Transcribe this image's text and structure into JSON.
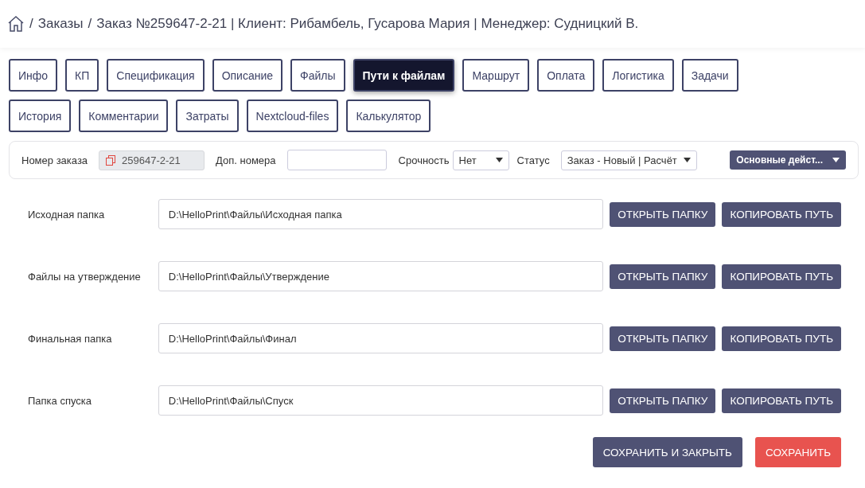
{
  "breadcrumb": {
    "separator": "/",
    "items": [
      "Заказы",
      "Заказ №259647-2-21 | Клиент: Рибамбель, Гусарова Мария | Менеджер: Судницкий В."
    ]
  },
  "tabs": [
    {
      "label": "Инфо",
      "selected": false
    },
    {
      "label": "КП",
      "selected": false
    },
    {
      "label": "Спецификация",
      "selected": false
    },
    {
      "label": "Описание",
      "selected": false
    },
    {
      "label": "Файлы",
      "selected": false
    },
    {
      "label": "Пути к файлам",
      "selected": true
    },
    {
      "label": "Маршрут",
      "selected": false
    },
    {
      "label": "Оплата",
      "selected": false
    },
    {
      "label": "Логистика",
      "selected": false
    },
    {
      "label": "Задачи",
      "selected": false
    },
    {
      "label": "История",
      "selected": false
    },
    {
      "label": "Комментарии",
      "selected": false
    },
    {
      "label": "Затраты",
      "selected": false
    },
    {
      "label": "Nextcloud-files",
      "selected": false
    },
    {
      "label": "Калькулятор",
      "selected": false
    }
  ],
  "info_bar": {
    "order_number_label": "Номер заказа",
    "order_number": "259647-2-21",
    "extra_numbers_label": "Доп. номера",
    "urgency_label": "Срочность",
    "urgency": "Нет",
    "status_label": "Статус",
    "status": "Заказ - Новый | Расчёт",
    "actions_button": "Основные дейст..."
  },
  "paths": [
    {
      "label": "Исходная папка",
      "value": "D:\\HelloPrint\\Файлы\\Исходная папка",
      "open_button": "ОТКРЫТЬ ПАПКУ",
      "copy_button": "КОПИРОВАТЬ ПУТЬ"
    },
    {
      "label": "Файлы на утверждение",
      "value": "D:\\HelloPrint\\Файлы\\Утверждение",
      "open_button": "ОТКРЫТЬ ПАПКУ",
      "copy_button": "КОПИРОВАТЬ ПУТЬ"
    },
    {
      "label": "Финальная папка",
      "value": "D:\\HelloPrint\\Файлы\\Финал",
      "open_button": "ОТКРЫТЬ ПАПКУ",
      "copy_button": "КОПИРОВАТЬ ПУТЬ"
    },
    {
      "label": "Папка спуска",
      "value": "D:\\HelloPrint\\Файлы\\Спуск",
      "open_button": "ОТКРЫТЬ ПАПКУ",
      "copy_button": "КОПИРОВАТЬ ПУТЬ"
    }
  ],
  "footer_buttons": [
    {
      "label": "СОХРАНИТЬ И ЗАКРЫТЬ",
      "kind": "secondary"
    },
    {
      "label": "СОХРАНИТЬ",
      "kind": "danger"
    }
  ]
}
